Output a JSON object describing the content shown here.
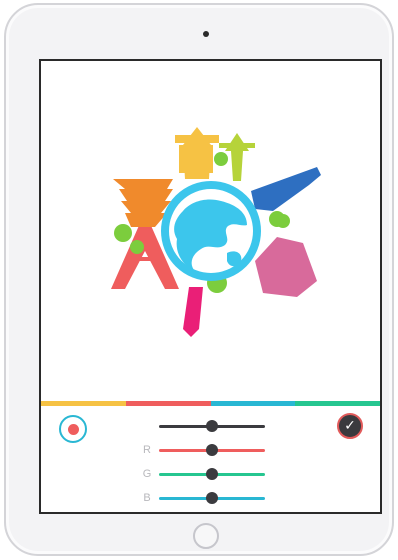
{
  "colors": {
    "yellow": "#f6c244",
    "red": "#ef5d5d",
    "cyan": "#29b7d3",
    "green": "#26c690",
    "orange": "#f08a2c",
    "pink": "#ea1f77",
    "magenta": "#d86a9b",
    "blue": "#2e6fc1",
    "leaf": "#7ccd3d",
    "globe": "#3cc6ec",
    "track_dark": "#3b3b3f"
  },
  "palette_strip": [
    "#f6c244",
    "#ef5d5d",
    "#29b7d3",
    "#26c690"
  ],
  "artwork": {
    "subject": "travel-landmarks-globe"
  },
  "controls": {
    "reset_icon": "color-reset-icon",
    "confirm_glyph": "✓",
    "sliders": [
      {
        "id": "brightness",
        "label": "",
        "value": 0.5,
        "color": "#3b3b3f"
      },
      {
        "id": "red",
        "label": "R",
        "value": 0.5,
        "color": "#ef5d5d"
      },
      {
        "id": "green",
        "label": "G",
        "value": 0.5,
        "color": "#26c690"
      },
      {
        "id": "blue",
        "label": "B",
        "value": 0.5,
        "color": "#29b7d3"
      }
    ]
  }
}
